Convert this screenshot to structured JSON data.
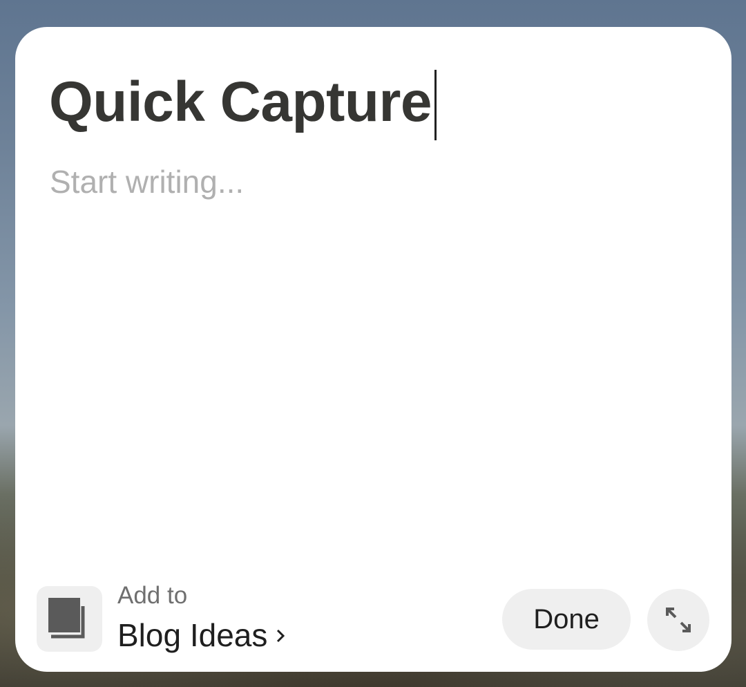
{
  "note": {
    "title": "Quick Capture",
    "body_placeholder": "Start writing..."
  },
  "footer": {
    "add_to_label": "Add to",
    "notebook_name": "Blog Ideas",
    "notebook_icon": "notebook-stack-icon",
    "done_label": "Done",
    "expand_icon": "expand-arrows-icon"
  },
  "colors": {
    "title": "#363633",
    "placeholder": "#b0b0b0",
    "card": "#ffffff",
    "button_bg": "#efefef",
    "icon_dark": "#5a5a5a"
  }
}
